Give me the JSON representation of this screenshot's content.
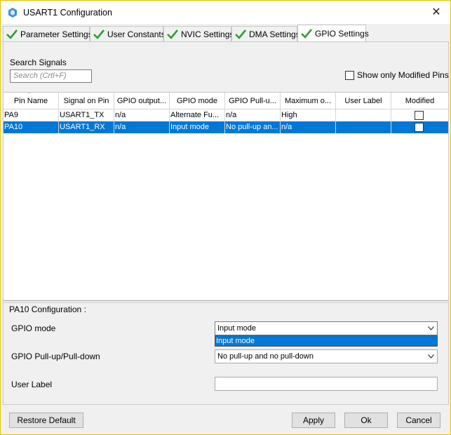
{
  "window": {
    "title": "USART1 Configuration",
    "close_glyph": "✕"
  },
  "tabs": [
    {
      "label": "Parameter Settings",
      "icon": "check-icon"
    },
    {
      "label": "User Constants",
      "icon": "check-icon"
    },
    {
      "label": "NVIC Settings",
      "icon": "check-icon"
    },
    {
      "label": "DMA Settings",
      "icon": "check-icon"
    },
    {
      "label": "GPIO Settings",
      "icon": "check-icon",
      "active": true
    }
  ],
  "search": {
    "label": "Search Signals",
    "placeholder": "Search (Crtl+F)"
  },
  "filter": {
    "label": "Show only Modified Pins"
  },
  "table": {
    "sort_glyph": "^",
    "columns": [
      "Pin Name",
      "Signal on Pin",
      "GPIO output...",
      "GPIO mode",
      "GPIO Pull-u...",
      "Maximum o...",
      "User Label",
      "Modified"
    ],
    "rows": [
      {
        "cells": [
          "PA9",
          "USART1_TX",
          "n/a",
          "Alternate Fu...",
          "n/a",
          "High",
          ""
        ],
        "modified": false,
        "selected": false
      },
      {
        "cells": [
          "PA10",
          "USART1_RX",
          "n/a",
          "Input mode",
          "No pull-up an...",
          "n/a",
          ""
        ],
        "modified": false,
        "selected": true
      }
    ]
  },
  "config": {
    "title": "PA10 Configuration :",
    "gpio_mode_label": "GPIO mode",
    "gpio_mode_value": "Input mode",
    "gpio_mode_option": "Input mode",
    "pull_label": "GPIO Pull-up/Pull-down",
    "pull_value": "No pull-up and no pull-down",
    "user_label_label": "User Label",
    "user_label_value": ""
  },
  "buttons": {
    "restore": "Restore Default",
    "apply": "Apply",
    "ok": "Ok",
    "cancel": "Cancel"
  },
  "colors": {
    "selection": "#0078d7",
    "check": "#2e9e2e",
    "border_accent": "#e6c800"
  }
}
